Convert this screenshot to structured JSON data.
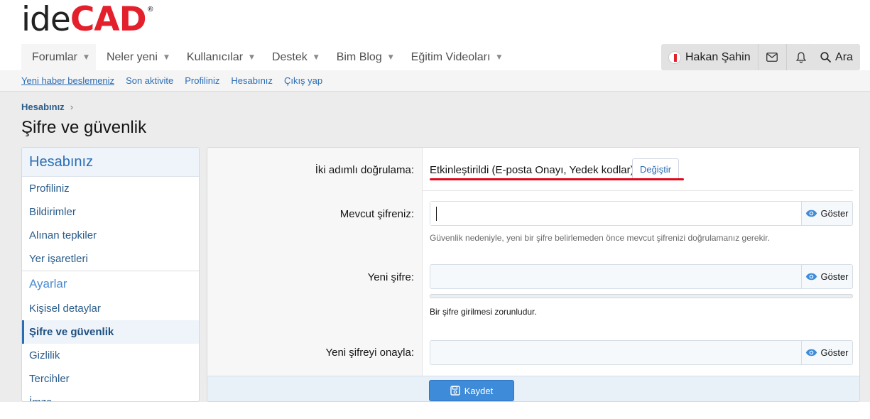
{
  "logo": {
    "part1": "ide",
    "part2": "CAD",
    "mark": "®"
  },
  "nav": {
    "tabs": [
      {
        "label": "Forumlar"
      },
      {
        "label": "Neler yeni"
      },
      {
        "label": "Kullanıcılar"
      },
      {
        "label": "Destek"
      },
      {
        "label": "Bim Blog"
      },
      {
        "label": "Eğitim Videoları"
      }
    ],
    "user_name": "Hakan Şahin",
    "search_label": "Ara"
  },
  "subnav": {
    "links": [
      {
        "label": "Yeni haber beslemeniz"
      },
      {
        "label": "Son aktivite"
      },
      {
        "label": "Profiliniz"
      },
      {
        "label": "Hesabınız"
      },
      {
        "label": "Çıkış yap"
      }
    ]
  },
  "breadcrumb": {
    "label": "Hesabınız"
  },
  "page_title": "Şifre ve güvenlik",
  "sidebar": {
    "heading": "Hesabınız",
    "items": [
      {
        "label": "Profiliniz"
      },
      {
        "label": "Bildirimler"
      },
      {
        "label": "Alınan tepkiler"
      },
      {
        "label": "Yer işaretleri"
      }
    ],
    "section": "Ayarlar",
    "settings_items": [
      {
        "label": "Kişisel detaylar"
      },
      {
        "label": "Şifre ve güvenlik"
      },
      {
        "label": "Gizlilik"
      },
      {
        "label": "Tercihler"
      },
      {
        "label": "İmza"
      }
    ]
  },
  "form": {
    "tfa_label": "İki adımlı doğrulama:",
    "tfa_value": "Etkinleştirildi (E-posta Onayı, Yedek kodlar)",
    "change_label": "Değiştir",
    "current_label": "Mevcut şifreniz:",
    "current_value": "",
    "current_hint": "Güvenlik nedeniyle, yeni bir şifre belirlemeden önce mevcut şifrenizi doğrulamanız gerekir.",
    "new_label": "Yeni şifre:",
    "new_value": "",
    "new_hint": "Bir şifre girilmesi zorunludur.",
    "confirm_label": "Yeni şifreyi onayla:",
    "confirm_value": "",
    "show_label": "Göster",
    "save_label": "Kaydet"
  },
  "colors": {
    "brand_red": "#e3202b",
    "link_blue": "#2a6db5",
    "button_blue": "#3d8bd9"
  }
}
